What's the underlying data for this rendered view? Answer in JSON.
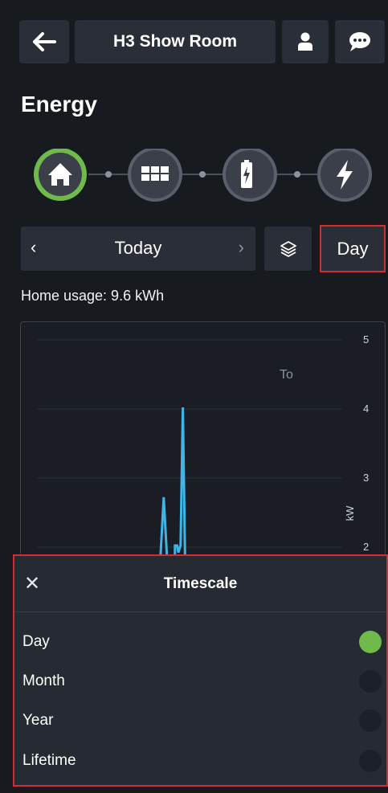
{
  "header": {
    "title": "H3 Show Room"
  },
  "page": {
    "title": "Energy"
  },
  "date_nav": {
    "prev": "‹",
    "label": "Today",
    "next": "›",
    "timescale_button": "Day"
  },
  "usage_text": "Home usage: 9.6 kWh",
  "chart_data": {
    "type": "line",
    "y_ticks": [
      "5",
      "4",
      "3",
      "2"
    ],
    "ylabel": "kW",
    "legend_partial": "To",
    "series": [
      {
        "color": "#3fb4e8",
        "points": [
          [
            0,
            0
          ],
          [
            1,
            0.2
          ],
          [
            1.2,
            1.8
          ],
          [
            1.35,
            2.7
          ],
          [
            1.5,
            1.8
          ],
          [
            1.7,
            0.5
          ],
          [
            1.8,
            0.4
          ],
          [
            1.85,
            2.0
          ],
          [
            1.95,
            2.0
          ],
          [
            2.0,
            1.9
          ],
          [
            2.1,
            2.0
          ],
          [
            2.2,
            4.0
          ],
          [
            2.3,
            1.8
          ],
          [
            2.4,
            0.2
          ]
        ]
      }
    ],
    "ylim": [
      0,
      5
    ],
    "colors": {
      "accent": "#3fb4e8"
    }
  },
  "timescale_sheet": {
    "title": "Timescale",
    "close": "✕",
    "options": [
      {
        "label": "Day",
        "selected": true
      },
      {
        "label": "Month",
        "selected": false
      },
      {
        "label": "Year",
        "selected": false
      },
      {
        "label": "Lifetime",
        "selected": false
      }
    ]
  },
  "colors": {
    "background": "#171a1f",
    "button": "#2a2e37",
    "highlight": "#d62b35",
    "active_green": "#6fba4a"
  }
}
